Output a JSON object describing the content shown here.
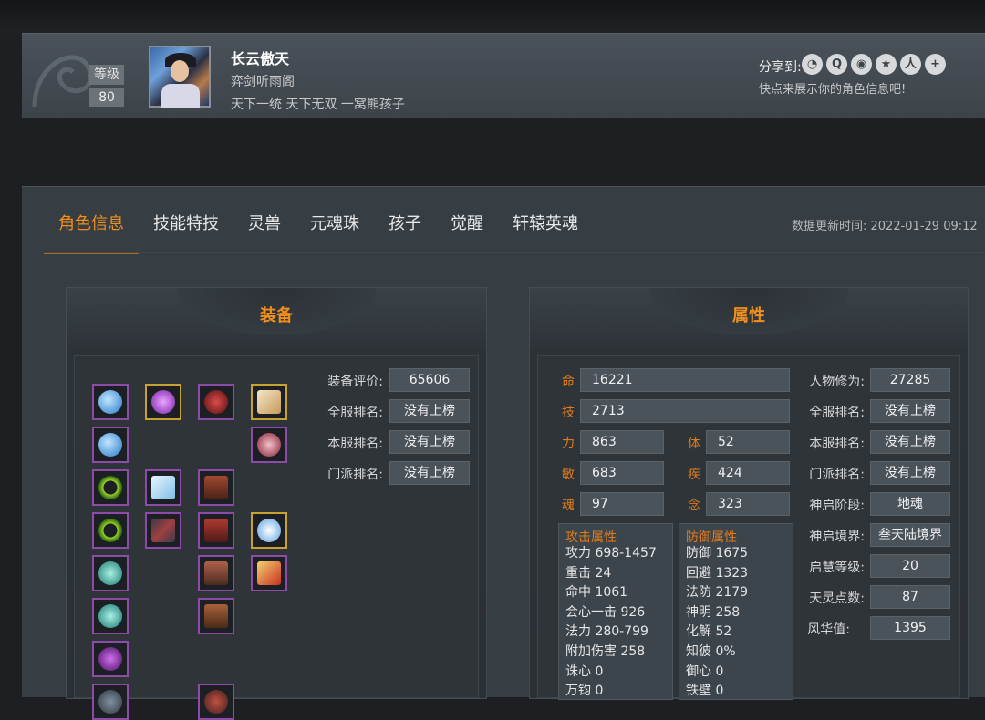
{
  "header": {
    "level_label": "等级",
    "level_value": "80",
    "char_name": "长云傲天",
    "guild": "弈剑听雨阁",
    "motto": "天下一统 天下无双 一窝熊孩子",
    "share_label": "分享到:",
    "share_hint": "快点来展示你的角色信息吧!",
    "share_icons": [
      "wechat-icon",
      "qq-icon",
      "weibo-icon",
      "qzone-icon",
      "renren-icon",
      "more-icon"
    ]
  },
  "tabs": [
    "角色信息",
    "技能特技",
    "灵兽",
    "元魂珠",
    "孩子",
    "觉醒",
    "轩辕英魂"
  ],
  "active_tab": "角色信息",
  "update_time": "数据更新时间:  2022-01-29 09:12",
  "equipment": {
    "title": "装备",
    "stats": [
      {
        "label": "装备评价:",
        "value": "65606"
      },
      {
        "label": "全服排名:",
        "value": "没有上榜"
      },
      {
        "label": "本服排名:",
        "value": "没有上榜"
      },
      {
        "label": "门派排名:",
        "value": "没有上榜"
      }
    ]
  },
  "attributes": {
    "title": "属性",
    "primary": [
      {
        "label": "命",
        "value": "16221"
      },
      {
        "label": "技",
        "value": "2713"
      },
      {
        "label": "力",
        "value": "863"
      },
      {
        "label": "体",
        "value": "52"
      },
      {
        "label": "敏",
        "value": "683"
      },
      {
        "label": "疾",
        "value": "424"
      },
      {
        "label": "魂",
        "value": "97"
      },
      {
        "label": "念",
        "value": "323"
      }
    ],
    "attack": {
      "title": "攻击属性",
      "rows": [
        "攻力 698-1457",
        "重击 24",
        "命中 1061",
        "会心一击 926",
        "法力 280-799",
        "附加伤害 258",
        "诛心 0",
        "万钧 0"
      ]
    },
    "defense": {
      "title": "防御属性",
      "rows": [
        "防御 1675",
        "回避 1323",
        "法防 2179",
        "神明 258",
        "化解 52",
        "知彼 0%",
        "御心 0",
        "铁壁 0"
      ]
    },
    "right": [
      {
        "label": "人物修为:",
        "value": "27285"
      },
      {
        "label": "全服排名:",
        "value": "没有上榜"
      },
      {
        "label": "本服排名:",
        "value": "没有上榜"
      },
      {
        "label": "门派排名:",
        "value": "没有上榜"
      },
      {
        "label": "神启阶段:",
        "value": "地魂"
      },
      {
        "label": "神启境界:",
        "value": "叁天陆境界"
      },
      {
        "label": "启慧等级:",
        "value": "20"
      },
      {
        "label": "天灵点数:",
        "value": "87"
      },
      {
        "label": "风华值:",
        "value": "1395"
      }
    ]
  },
  "colors": {
    "accent": "#f08f1c",
    "panel": "#363d43",
    "box": "#4a525a",
    "slot_purple": "#8e4aa8",
    "slot_gold": "#c8a230"
  }
}
